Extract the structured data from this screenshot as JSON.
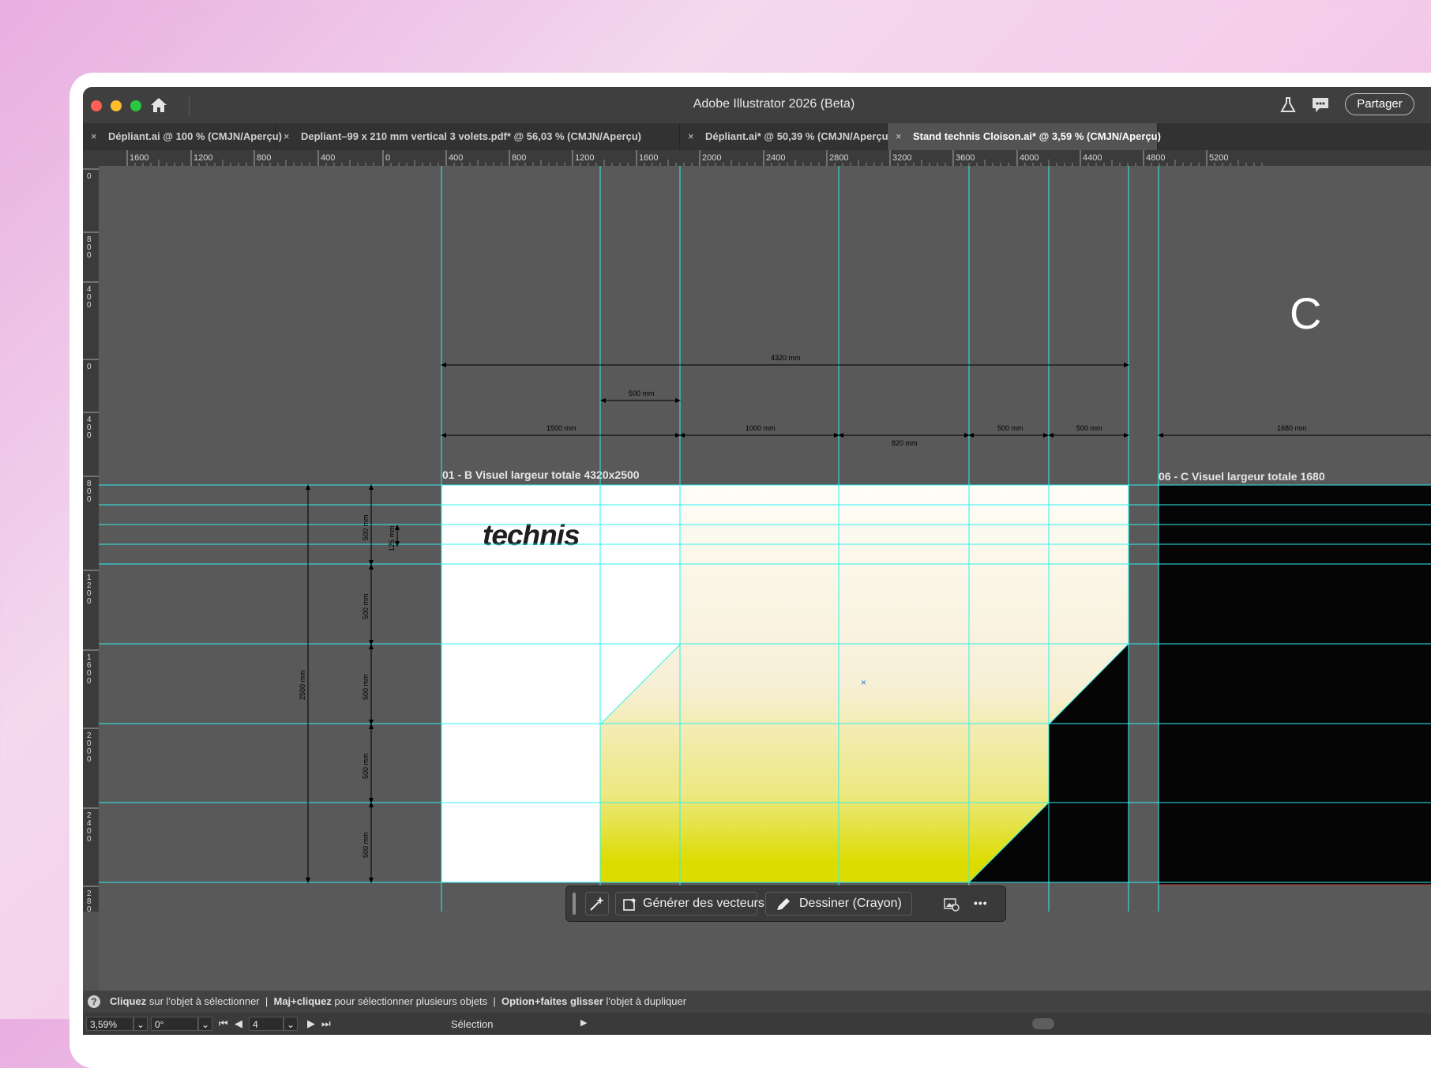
{
  "app": {
    "title": "Adobe Illustrator 2026 (Beta)",
    "share_label": "Partager",
    "partial_glyph": "C"
  },
  "tabs": [
    {
      "label": "Dépliant.ai @ 100 % (CMJN/Aperçu)",
      "close": "×",
      "active": false
    },
    {
      "label": "Depliant–99 x 210 mm vertical 3 volets.pdf* @ 56,03 % (CMJN/Aperçu)",
      "close": "×",
      "active": false
    },
    {
      "label": "Dépliant.ai* @ 50,39 % (CMJN/Aperçu)",
      "close": "×",
      "active": false
    },
    {
      "label": "Stand technis Cloison.ai* @ 3,59 % (CMJN/Aperçu)",
      "close": "×",
      "active": true
    }
  ],
  "ruler": {
    "horizontal": [
      "1600",
      "1200",
      "800",
      "400",
      "0",
      "400",
      "800",
      "1200",
      "1600",
      "2000",
      "2400",
      "2800",
      "3200",
      "3600",
      "4000",
      "4400",
      "4800",
      "5200"
    ],
    "vertical": [
      "0",
      "800",
      "400",
      "0",
      "400",
      "800",
      "1200",
      "1600",
      "2000",
      "2400",
      "2800"
    ]
  },
  "artboards": [
    {
      "label": "01 - B Visuel largeur totale 4320x2500"
    },
    {
      "label": "06 - C Visuel largeur totale 1680"
    }
  ],
  "logo_text": "technis",
  "dimensions": {
    "total": "4320 mm",
    "top500": "500 mm",
    "d1500": "1500 mm",
    "d1000": "1000 mm",
    "d820": "820 mm",
    "d500a": "500 mm",
    "d500b": "500 mm",
    "d1680": "1680 mm",
    "height_total": "2500 mm",
    "v1": "500 mm",
    "v2": "500 mm",
    "v3": "500 mm",
    "v4": "500 mm",
    "v5": "500 mm",
    "small": "125 mm"
  },
  "floating_toolbar": {
    "generate_label": "Générer des vecteurs",
    "draw_label": "Dessiner (Crayon)",
    "more": "•••"
  },
  "status": {
    "help": "?",
    "p1_bold": "Cliquez",
    "p1": " sur l'objet à sélectionner",
    "sep": "|",
    "p2_bold": "Maj+cliquez",
    "p2": " pour sélectionner plusieurs objets",
    "p3_bold": "Option+faites glisser",
    "p3": " l'objet à dupliquer"
  },
  "bottom": {
    "zoom": "3,59%",
    "rotation": "0°",
    "artboard_num": "4",
    "tool": "Sélection"
  },
  "colors": {
    "guide": "#2ff0f0",
    "yellow": "#dcdc00",
    "cream": "#fdf8ec",
    "black": "#050505",
    "canvas": "#595959"
  }
}
